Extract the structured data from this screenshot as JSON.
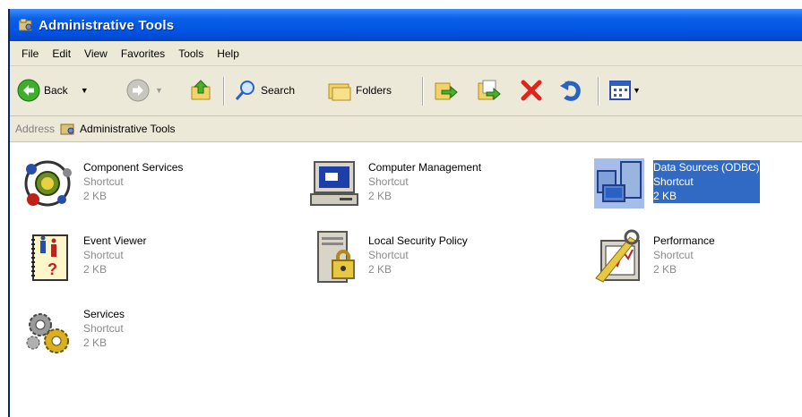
{
  "window": {
    "title": "Administrative Tools"
  },
  "menu": [
    "File",
    "Edit",
    "View",
    "Favorites",
    "Tools",
    "Help"
  ],
  "toolbar": {
    "back_label": "Back",
    "search_label": "Search",
    "folders_label": "Folders"
  },
  "address": {
    "label": "Address",
    "value": "Administrative Tools"
  },
  "items": [
    {
      "name": "Component Services",
      "type": "Shortcut",
      "size": "2 KB",
      "icon": "component-services-icon",
      "selected": false
    },
    {
      "name": "Computer Management",
      "type": "Shortcut",
      "size": "2 KB",
      "icon": "computer-management-icon",
      "selected": false
    },
    {
      "name": "Data Sources (ODBC)",
      "type": "Shortcut",
      "size": "2 KB",
      "icon": "data-sources-icon",
      "selected": true
    },
    {
      "name": "Event Viewer",
      "type": "Shortcut",
      "size": "2 KB",
      "icon": "event-viewer-icon",
      "selected": false
    },
    {
      "name": "Local Security Policy",
      "type": "Shortcut",
      "size": "2 KB",
      "icon": "local-security-policy-icon",
      "selected": false
    },
    {
      "name": "Performance",
      "type": "Shortcut",
      "size": "2 KB",
      "icon": "performance-icon",
      "selected": false
    },
    {
      "name": "Services",
      "type": "Shortcut",
      "size": "2 KB",
      "icon": "services-icon",
      "selected": false
    }
  ],
  "colors": {
    "titlebar": "#0054e3",
    "chrome": "#ece9d8",
    "selection": "#316ac5"
  }
}
